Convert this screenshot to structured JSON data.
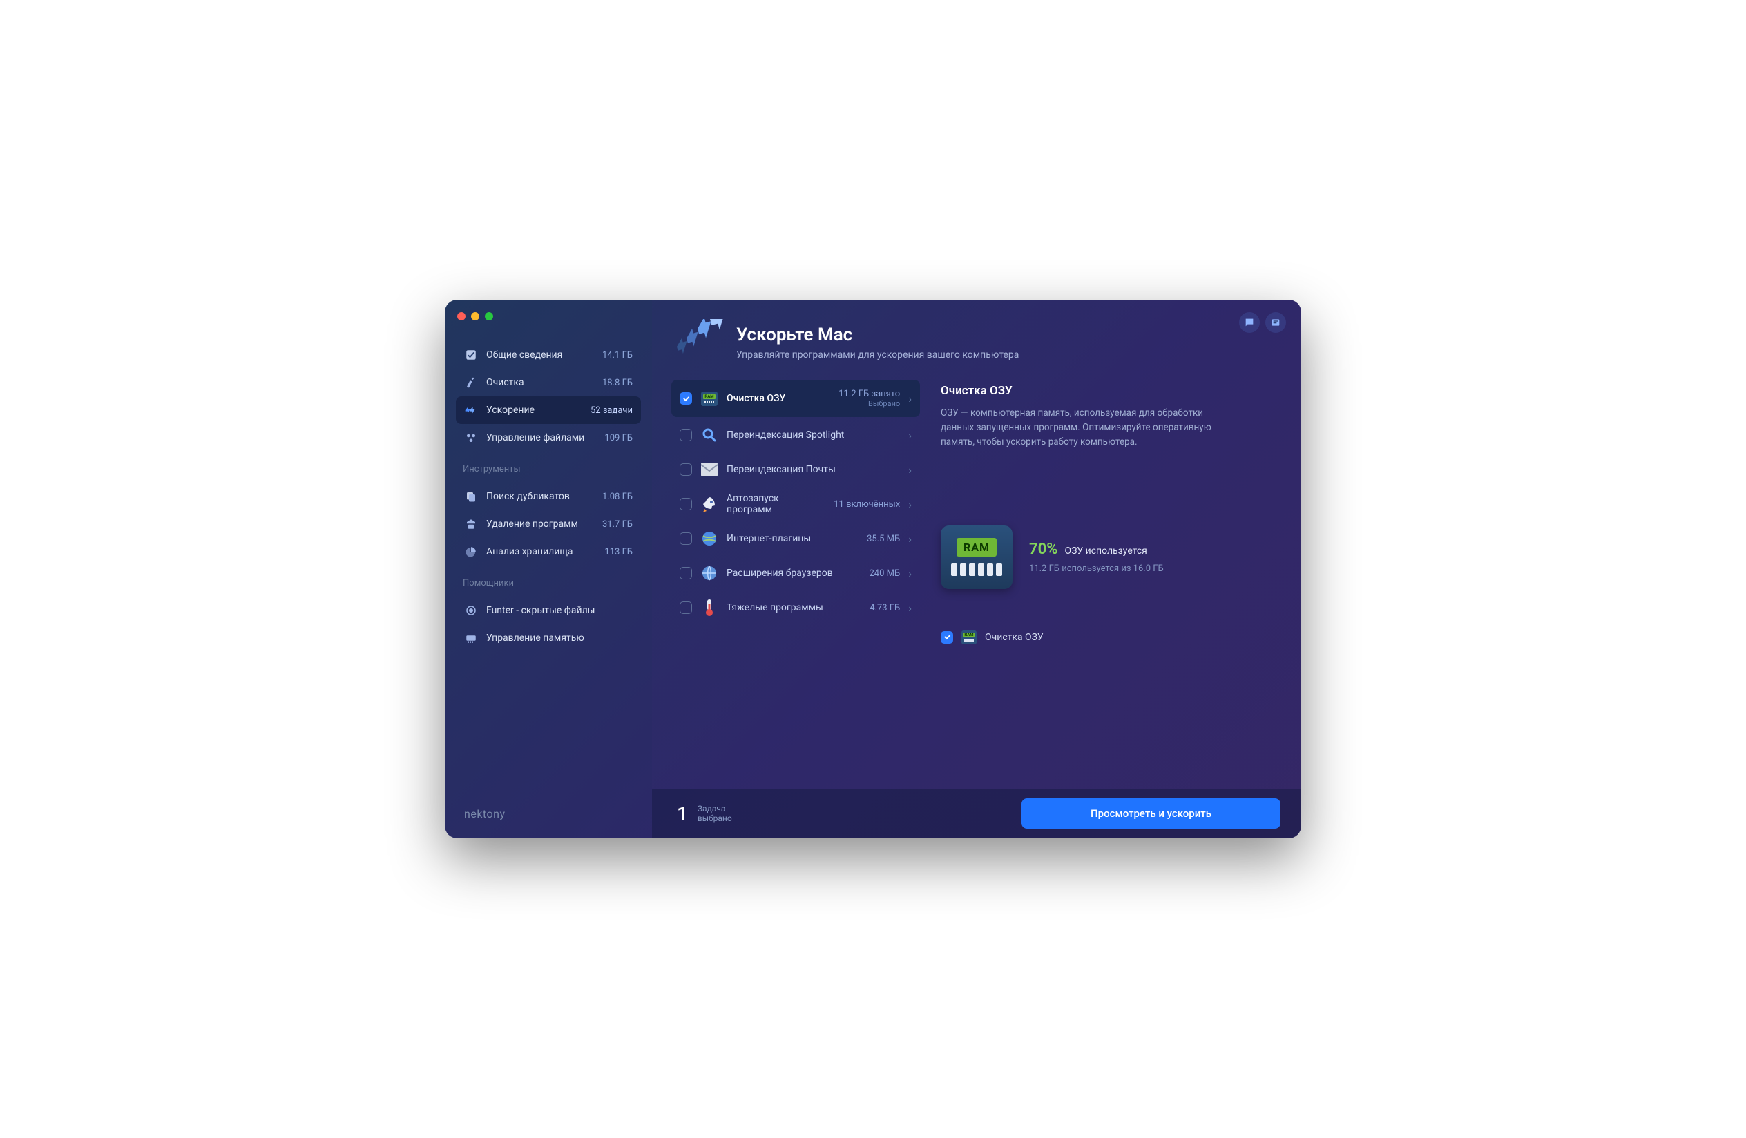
{
  "header": {
    "title": "Ускорьте Mac",
    "subtitle": "Управляйте программами для ускорения вашего компьютера"
  },
  "sidebar": {
    "items": [
      {
        "label": "Общие сведения",
        "badge": "14.1 ГБ"
      },
      {
        "label": "Очистка",
        "badge": "18.8 ГБ"
      },
      {
        "label": "Ускорение",
        "badge": "52 задачи"
      },
      {
        "label": "Управление файлами",
        "badge": "109 ГБ"
      }
    ],
    "tools_title": "Инструменты",
    "tools": [
      {
        "label": "Поиск дубликатов",
        "badge": "1.08 ГБ"
      },
      {
        "label": "Удаление программ",
        "badge": "31.7 ГБ"
      },
      {
        "label": "Анализ хранилища",
        "badge": "113 ГБ"
      }
    ],
    "helpers_title": "Помощники",
    "helpers": [
      {
        "label": "Funter - скрытые файлы"
      },
      {
        "label": "Управление памятью"
      }
    ]
  },
  "tasks": [
    {
      "title": "Очистка ОЗУ",
      "meta": "11.2 ГБ занято",
      "sub": "Выбрано",
      "checked": true
    },
    {
      "title": "Переиндексация Spotlight",
      "meta": "",
      "checked": false
    },
    {
      "title": "Переиндексация Почты",
      "meta": "",
      "checked": false
    },
    {
      "title": "Автозапуск программ",
      "meta": "11 включённых",
      "checked": false
    },
    {
      "title": "Интернет-плагины",
      "meta": "35.5 МБ",
      "checked": false
    },
    {
      "title": "Расширения браузеров",
      "meta": "240 МБ",
      "checked": false
    },
    {
      "title": "Тяжелые программы",
      "meta": "4.73 ГБ",
      "checked": false
    }
  ],
  "detail": {
    "title": "Очистка ОЗУ",
    "desc": "ОЗУ — компьютерная память, используемая для обработки данных запущенных программ. Оптимизируйте оперативную память, чтобы ускорить работу компьютера.",
    "ram_badge": "RAM",
    "pct": "70%",
    "pct_label": "ОЗУ используется",
    "usage": "11.2 ГБ используется из 16.0 ГБ",
    "selected_label": "Очистка ОЗУ"
  },
  "footer": {
    "count": "1",
    "label": "Задача",
    "sub": "выбрано",
    "cta": "Просмотреть и ускорить"
  },
  "brand": "nektony"
}
